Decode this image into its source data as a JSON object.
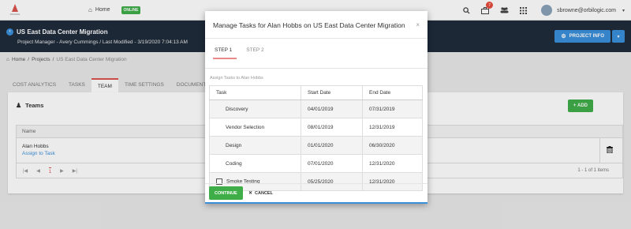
{
  "topnav": {
    "logo_text": "IMAGINE",
    "home_label": "Home",
    "status_badge": "ONLINE",
    "notification_count": "7",
    "user_email": "sbrowne@orbilogic.com"
  },
  "project": {
    "title": "US East Data Center Migration",
    "subtitle": "Project Manager - Avery Cummings  /  Last Modified - 3/19/2020 7:04:13 AM",
    "info_button": "PROJECT INFO"
  },
  "breadcrumb": {
    "home": "Home",
    "sep": "/",
    "projects": "Projects",
    "current": "US East Data Center Migration"
  },
  "tabs": [
    {
      "label": "COST ANALYTICS",
      "active": false
    },
    {
      "label": "TASKS",
      "active": false
    },
    {
      "label": "TEAM",
      "active": true
    },
    {
      "label": "TIME SETTINGS",
      "active": false
    },
    {
      "label": "DOCUMENTS",
      "active": false
    }
  ],
  "team_card": {
    "title": "Teams",
    "add_button": "ADD",
    "column_name": "Name",
    "member_name": "Alan Hobbs",
    "assign_link": "Assign to Task",
    "page_number": "1",
    "items_count": "1 - 1 of 1 items"
  },
  "modal": {
    "title": "Manage Tasks for Alan Hobbs on US East Data Center Migration",
    "close": "×",
    "steps": [
      "STEP 1",
      "STEP 2"
    ],
    "assign_label": "Assign Tasks to Alan Hobbs",
    "columns": [
      "Task",
      "Start Date",
      "End Date"
    ],
    "rows": [
      {
        "task": "Discovery",
        "start": "04/01/2019",
        "end": "07/31/2019",
        "checkbox": false
      },
      {
        "task": "Vendor Selection",
        "start": "08/01/2019",
        "end": "12/31/2019",
        "checkbox": false
      },
      {
        "task": "Design",
        "start": "01/01/2020",
        "end": "06/30/2020",
        "checkbox": false
      },
      {
        "task": "Coding",
        "start": "07/01/2020",
        "end": "12/31/2020",
        "checkbox": false
      },
      {
        "task": "Smoke Testing",
        "start": "05/25/2020",
        "end": "12/31/2020",
        "checkbox": true
      }
    ],
    "continue_button": "CONTINUE",
    "cancel_button": "CANCEL"
  },
  "colors": {
    "header_bg": "#202c3c",
    "accent_blue": "#3a8fd9",
    "accent_green": "#3fae49",
    "accent_red": "#d9534f"
  },
  "icons": [
    "home-icon",
    "search-icon",
    "briefcase-icon",
    "users-icon",
    "grid-icon",
    "back-icon",
    "gear-icon",
    "team-icon",
    "trash-icon",
    "close-icon"
  ]
}
